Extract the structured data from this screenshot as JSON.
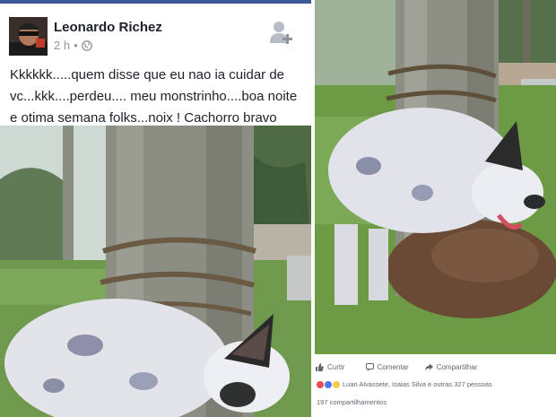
{
  "post": {
    "author": "Leonardo Richez",
    "time": "2 h",
    "separator": "•",
    "text": "Kkkkkk.....quem disse que eu nao ia cuidar de vc...kkk....perdeu.... meu monstrinho....boa noite e otima semana folks...noix ! Cachorro bravo"
  },
  "actions": {
    "like": "Curtir",
    "comment": "Comentar",
    "share": "Compartilhar"
  },
  "reactions": {
    "summary": "Luan Alvassete, Isaias Silva e outras 327 pessoas"
  },
  "shares": {
    "count": "197 compartilhamentos"
  },
  "colors": {
    "brand": "#3b5998",
    "text": "#1d2129",
    "muted": "#90949c"
  }
}
